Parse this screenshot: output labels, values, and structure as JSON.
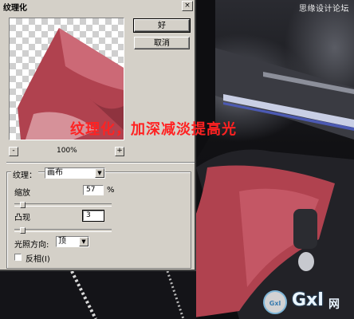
{
  "dialog": {
    "title": "纹理化",
    "ok_label": "好",
    "cancel_label": "取消",
    "zoom": {
      "minus": "-",
      "value": "100%",
      "plus": "+"
    },
    "texture": {
      "label": "纹理：",
      "value": "画布"
    },
    "scaling": {
      "label": "缩放",
      "value": "57",
      "unit": "%",
      "level": 0.06
    },
    "relief": {
      "label": "凸现",
      "value": "3",
      "level": 0.06
    },
    "light": {
      "label": "光照方向:",
      "value": "顶"
    },
    "invert": {
      "label": "反相(I)",
      "checked": false
    }
  },
  "overlay": {
    "caption": "纹理化，加深减淡提高光",
    "watermark_top": "思缘设计论坛",
    "logo_text": "Gxl",
    "logo_sub": "网",
    "logo_badge": "Gxl"
  },
  "colors": {
    "caption": "#ff2222",
    "dialog_bg": "#d4d0c8",
    "fabric": "#b0424f"
  }
}
